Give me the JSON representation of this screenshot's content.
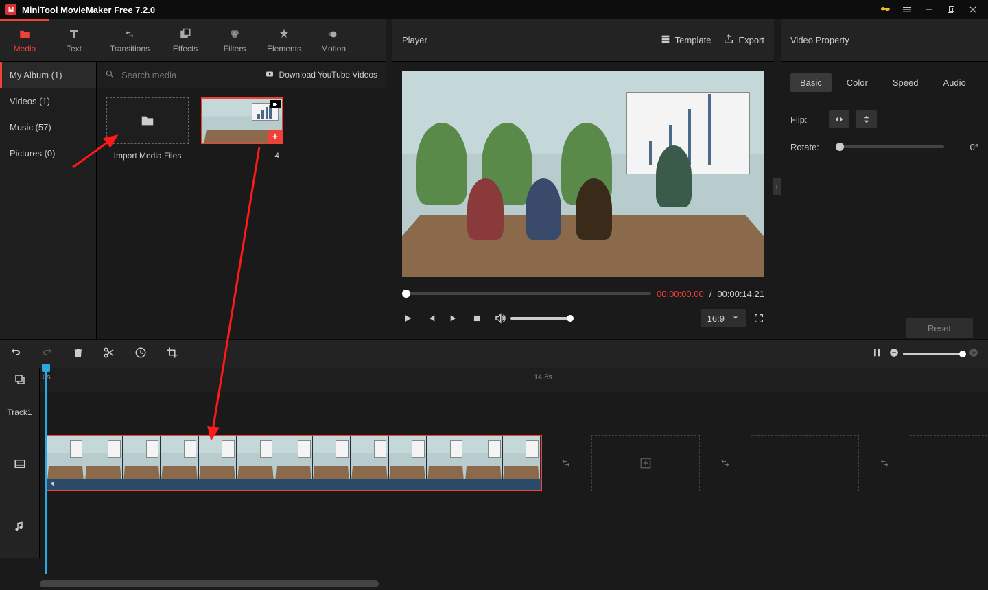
{
  "app": {
    "title": "MiniTool MovieMaker Free 7.2.0"
  },
  "tabs": {
    "media": "Media",
    "text": "Text",
    "transitions": "Transitions",
    "effects": "Effects",
    "filters": "Filters",
    "elements": "Elements",
    "motion": "Motion"
  },
  "library": {
    "sidebar": {
      "my_album": "My Album (1)",
      "videos": "Videos (1)",
      "music": "Music (57)",
      "pictures": "Pictures (0)"
    },
    "search_placeholder": "Search media",
    "download_link": "Download YouTube Videos",
    "import_label": "Import Media Files",
    "clip_duration": "4"
  },
  "player": {
    "title": "Player",
    "template": "Template",
    "export": "Export",
    "time_current": "00:00:00.00",
    "time_total": "00:00:14.21",
    "aspect": "16:9"
  },
  "props": {
    "title": "Video Property",
    "tabs": {
      "basic": "Basic",
      "color": "Color",
      "speed": "Speed",
      "audio": "Audio"
    },
    "flip_label": "Flip:",
    "rotate_label": "Rotate:",
    "rotate_value": "0°",
    "reset": "Reset"
  },
  "timeline": {
    "start_label": "0s",
    "mid_label": "14.8s",
    "track1": "Track1"
  }
}
